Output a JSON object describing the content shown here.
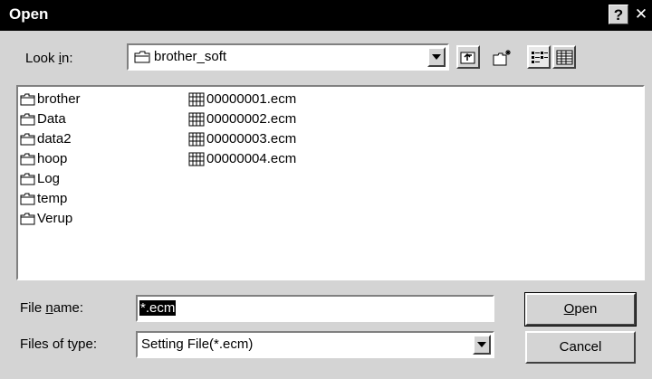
{
  "window": {
    "title": "Open",
    "help_glyph": "?",
    "close_glyph": "✕"
  },
  "lookin": {
    "label_pre": "Look ",
    "label_key": "i",
    "label_post": "n:",
    "value": "brother_soft",
    "icon": "folder-icon"
  },
  "toolbar": {
    "buttons": [
      "up-one-level-icon",
      "new-folder-icon",
      "list-view-icon",
      "details-view-icon"
    ]
  },
  "files": {
    "folders": [
      "brother",
      "Data",
      "data2",
      "hoop",
      "Log",
      "temp",
      "Verup"
    ],
    "files": [
      "00000001.ecm",
      "00000002.ecm",
      "00000003.ecm",
      "00000004.ecm"
    ]
  },
  "filename": {
    "label_pre": "File ",
    "label_key": "n",
    "label_post": "ame:",
    "value": "*.ecm"
  },
  "filetype": {
    "label": "Files of type:",
    "value": "Setting File(*.ecm)"
  },
  "buttons": {
    "open_key": "O",
    "open_rest": "pen",
    "cancel": "Cancel"
  },
  "colors": {
    "titlebar": "#000000",
    "dialog_bg": "#d4d4d4",
    "selection": "#000000"
  }
}
